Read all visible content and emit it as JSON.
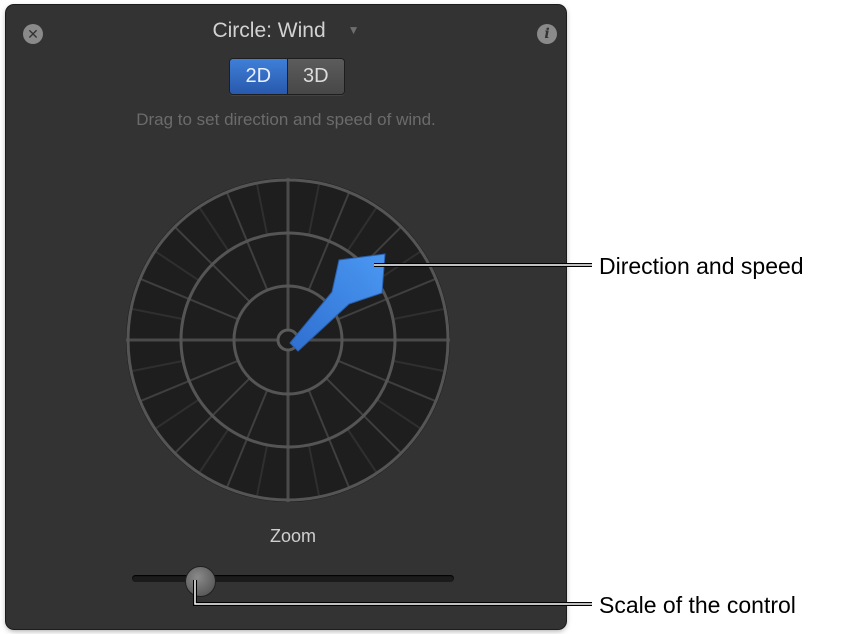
{
  "hud": {
    "title": "Circle: Wind",
    "close_glyph": "✕",
    "info_glyph": "i",
    "dropdown_glyph": "▼",
    "segments": [
      "2D",
      "3D"
    ],
    "selected_segment": "2D",
    "instruction": "Drag to set direction and speed of wind.",
    "zoom_label": "Zoom",
    "zoom_value": 0.2
  },
  "icons": {
    "close": "close-icon",
    "info": "info-icon",
    "dropdown": "dropdown-arrow-icon",
    "direction_arrow": "direction-arrow-icon"
  },
  "colors": {
    "panel": "#333333",
    "accent": "#3f7fd8",
    "arrow": "#3a86e8"
  },
  "callouts": {
    "direction": "Direction and speed",
    "scale": "Scale of the control"
  }
}
